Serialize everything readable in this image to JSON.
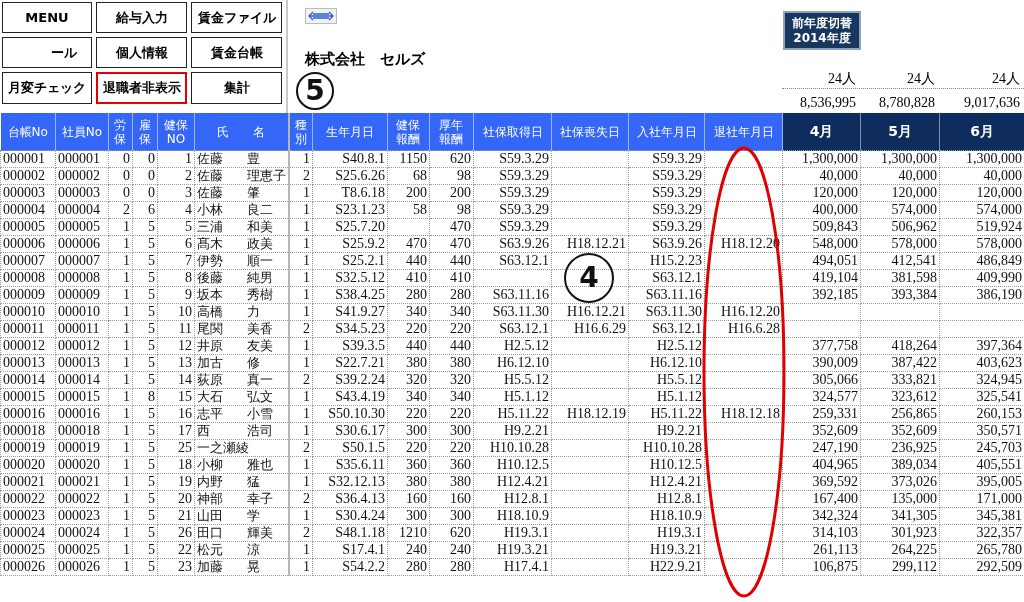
{
  "buttons": [
    {
      "label": "MENU",
      "highlighted": false
    },
    {
      "label": "給与入力",
      "highlighted": false
    },
    {
      "label": "賃金ファイル",
      "highlighted": false
    },
    {
      "label": "ール",
      "highlighted": false
    },
    {
      "label": "個人情報",
      "highlighted": false
    },
    {
      "label": "賃金台帳",
      "highlighted": false
    },
    {
      "label": "月変チェック",
      "highlighted": false
    },
    {
      "label": "退職者非表示",
      "highlighted": true
    },
    {
      "label": "集計",
      "highlighted": false
    }
  ],
  "company": "株式会社　セルズ",
  "year_switch": {
    "label": "前年度切替",
    "year": "2014年度"
  },
  "headcounts": [
    "24人",
    "24人",
    "24人"
  ],
  "totals": [
    "8,536,995",
    "8,780,828",
    "9,017,636"
  ],
  "columns": [
    "台帳No",
    "社員No",
    "労保",
    "雇保",
    "健保NO",
    "氏　　名",
    "種別",
    "生年月日",
    "健保報酬",
    "厚年報酬",
    "社保取得日",
    "社保喪失日",
    "入社年月日",
    "退社年月日",
    "4月",
    "5月",
    "6月"
  ],
  "rows": [
    {
      "ledger_no": "000001",
      "employee_no": "000001",
      "labor_ins": "0",
      "employment_ins": "0",
      "health_no": "1",
      "surname": "佐藤",
      "given_name": "豊",
      "type": "1",
      "birth_date": "S40.8.1",
      "health_pay": "1150",
      "pension_pay": "620",
      "ins_acquired": "S59.3.29",
      "hired": "S59.3.29",
      "m4": "1,300,000",
      "m5": "1,300,000",
      "m6": "1,300,000"
    },
    {
      "ledger_no": "000002",
      "employee_no": "000002",
      "labor_ins": "0",
      "employment_ins": "0",
      "health_no": "2",
      "surname": "佐藤",
      "given_name": "理恵子",
      "type": "2",
      "birth_date": "S25.6.26",
      "health_pay": "68",
      "pension_pay": "98",
      "ins_acquired": "S59.3.29",
      "hired": "S59.3.29",
      "m4": "40,000",
      "m5": "40,000",
      "m6": "40,000"
    },
    {
      "ledger_no": "000003",
      "employee_no": "000003",
      "labor_ins": "0",
      "employment_ins": "0",
      "health_no": "3",
      "surname": "佐藤",
      "given_name": "肇",
      "type": "1",
      "birth_date": "T8.6.18",
      "health_pay": "200",
      "pension_pay": "200",
      "ins_acquired": "S59.3.29",
      "hired": "S59.3.29",
      "m4": "120,000",
      "m5": "120,000",
      "m6": "120,000"
    },
    {
      "ledger_no": "000004",
      "employee_no": "000004",
      "labor_ins": "2",
      "employment_ins": "6",
      "health_no": "4",
      "surname": "小林",
      "given_name": "良二",
      "type": "1",
      "birth_date": "S23.1.23",
      "health_pay": "58",
      "pension_pay": "98",
      "ins_acquired": "S59.3.29",
      "hired": "S59.3.29",
      "m4": "400,000",
      "m5": "574,000",
      "m6": "574,000"
    },
    {
      "ledger_no": "000005",
      "employee_no": "000005",
      "labor_ins": "1",
      "employment_ins": "5",
      "health_no": "5",
      "surname": "三浦",
      "given_name": "和美",
      "type": "1",
      "birth_date": "S25.7.20",
      "pension_pay": "470",
      "ins_acquired": "S59.3.29",
      "hired": "S59.3.29",
      "m4": "509,843",
      "m5": "506,962",
      "m6": "519,924"
    },
    {
      "ledger_no": "000006",
      "employee_no": "000006",
      "labor_ins": "1",
      "employment_ins": "5",
      "health_no": "6",
      "surname": "髙木",
      "given_name": "政美",
      "type": "1",
      "birth_date": "S25.9.2",
      "health_pay": "470",
      "pension_pay": "470",
      "ins_acquired": "S63.9.26",
      "ins_lost": "H18.12.21",
      "hired": "S63.9.26",
      "retired": "H18.12.20",
      "m4": "548,000",
      "m5": "578,000",
      "m6": "578,000"
    },
    {
      "ledger_no": "000007",
      "employee_no": "000007",
      "labor_ins": "1",
      "employment_ins": "5",
      "health_no": "7",
      "surname": "伊勢",
      "given_name": "順一",
      "type": "1",
      "birth_date": "S25.2.1",
      "health_pay": "440",
      "pension_pay": "440",
      "ins_acquired": "S63.12.1",
      "hired": "H15.2.23",
      "m4": "494,051",
      "m5": "412,541",
      "m6": "486,849"
    },
    {
      "ledger_no": "000008",
      "employee_no": "000008",
      "labor_ins": "1",
      "employment_ins": "5",
      "health_no": "8",
      "surname": "後藤",
      "given_name": "純男",
      "type": "1",
      "birth_date": "S32.5.12",
      "health_pay": "410",
      "pension_pay": "410",
      "hired": "S63.12.1",
      "m4": "419,104",
      "m5": "381,598",
      "m6": "409,990"
    },
    {
      "ledger_no": "000009",
      "employee_no": "000009",
      "labor_ins": "1",
      "employment_ins": "5",
      "health_no": "9",
      "surname": "坂本",
      "given_name": "秀樹",
      "type": "1",
      "birth_date": "S38.4.25",
      "health_pay": "280",
      "pension_pay": "280",
      "ins_acquired": "S63.11.16",
      "hired": "S63.11.16",
      "m4": "392,185",
      "m5": "393,384",
      "m6": "386,190"
    },
    {
      "ledger_no": "000010",
      "employee_no": "000010",
      "labor_ins": "1",
      "employment_ins": "5",
      "health_no": "10",
      "surname": "高橋",
      "given_name": "力",
      "type": "1",
      "birth_date": "S41.9.27",
      "health_pay": "340",
      "pension_pay": "340",
      "ins_acquired": "S63.11.30",
      "ins_lost": "H16.12.21",
      "hired": "S63.11.30",
      "retired": "H16.12.20"
    },
    {
      "ledger_no": "000011",
      "employee_no": "000011",
      "labor_ins": "1",
      "employment_ins": "5",
      "health_no": "11",
      "surname": "尾関",
      "given_name": "美香",
      "type": "2",
      "birth_date": "S34.5.23",
      "health_pay": "220",
      "pension_pay": "220",
      "ins_acquired": "S63.12.1",
      "ins_lost": "H16.6.29",
      "hired": "S63.12.1",
      "retired": "H16.6.28"
    },
    {
      "ledger_no": "000012",
      "employee_no": "000012",
      "labor_ins": "1",
      "employment_ins": "5",
      "health_no": "12",
      "surname": "井原",
      "given_name": "友美",
      "type": "1",
      "birth_date": "S39.3.5",
      "health_pay": "440",
      "pension_pay": "440",
      "ins_acquired": "H2.5.12",
      "hired": "H2.5.12",
      "m4": "377,758",
      "m5": "418,264",
      "m6": "397,364"
    },
    {
      "ledger_no": "000013",
      "employee_no": "000013",
      "labor_ins": "1",
      "employment_ins": "5",
      "health_no": "13",
      "surname": "加古",
      "given_name": "修",
      "type": "1",
      "birth_date": "S22.7.21",
      "health_pay": "380",
      "pension_pay": "380",
      "ins_acquired": "H6.12.10",
      "hired": "H6.12.10",
      "m4": "390,009",
      "m5": "387,422",
      "m6": "403,623"
    },
    {
      "ledger_no": "000014",
      "employee_no": "000014",
      "labor_ins": "1",
      "employment_ins": "5",
      "health_no": "14",
      "surname": "荻原",
      "given_name": "真一",
      "type": "2",
      "birth_date": "S39.2.24",
      "health_pay": "320",
      "pension_pay": "320",
      "ins_acquired": "H5.5.12",
      "hired": "H5.5.12",
      "m4": "305,066",
      "m5": "333,821",
      "m6": "324,945"
    },
    {
      "ledger_no": "000015",
      "employee_no": "000015",
      "labor_ins": "1",
      "employment_ins": "8",
      "health_no": "15",
      "surname": "大石",
      "given_name": "弘文",
      "type": "1",
      "birth_date": "S43.4.19",
      "health_pay": "340",
      "pension_pay": "340",
      "ins_acquired": "H5.1.12",
      "hired": "H5.1.12",
      "m4": "324,577",
      "m5": "323,612",
      "m6": "325,541"
    },
    {
      "ledger_no": "000016",
      "employee_no": "000016",
      "labor_ins": "1",
      "employment_ins": "5",
      "health_no": "16",
      "surname": "志平",
      "given_name": "小雪",
      "type": "1",
      "birth_date": "S50.10.30",
      "health_pay": "220",
      "pension_pay": "220",
      "ins_acquired": "H5.11.22",
      "ins_lost": "H18.12.19",
      "hired": "H5.11.22",
      "retired": "H18.12.18",
      "m4": "259,331",
      "m5": "256,865",
      "m6": "260,153"
    },
    {
      "ledger_no": "000018",
      "employee_no": "000018",
      "labor_ins": "1",
      "employment_ins": "5",
      "health_no": "17",
      "surname": "西",
      "given_name": "浩司",
      "type": "1",
      "birth_date": "S30.6.17",
      "health_pay": "300",
      "pension_pay": "300",
      "ins_acquired": "H9.2.21",
      "hired": "H9.2.21",
      "m4": "352,609",
      "m5": "352,609",
      "m6": "350,571"
    },
    {
      "ledger_no": "000019",
      "employee_no": "000019",
      "labor_ins": "1",
      "employment_ins": "5",
      "health_no": "25",
      "surname": "一之瀬綾",
      "type": "2",
      "birth_date": "S50.1.5",
      "health_pay": "220",
      "pension_pay": "220",
      "ins_acquired": "H10.10.28",
      "hired": "H10.10.28",
      "m4": "247,190",
      "m5": "236,925",
      "m6": "245,703"
    },
    {
      "ledger_no": "000020",
      "employee_no": "000020",
      "labor_ins": "1",
      "employment_ins": "5",
      "health_no": "18",
      "surname": "小柳",
      "given_name": "雅也",
      "type": "1",
      "birth_date": "S35.6.11",
      "health_pay": "360",
      "pension_pay": "360",
      "ins_acquired": "H10.12.5",
      "hired": "H10.12.5",
      "m4": "404,965",
      "m5": "389,034",
      "m6": "405,551"
    },
    {
      "ledger_no": "000021",
      "employee_no": "000021",
      "labor_ins": "1",
      "employment_ins": "5",
      "health_no": "19",
      "surname": "内野",
      "given_name": "猛",
      "type": "1",
      "birth_date": "S32.12.13",
      "health_pay": "380",
      "pension_pay": "380",
      "ins_acquired": "H12.4.21",
      "hired": "H12.4.21",
      "m4": "369,592",
      "m5": "373,026",
      "m6": "395,005"
    },
    {
      "ledger_no": "000022",
      "employee_no": "000022",
      "labor_ins": "1",
      "employment_ins": "5",
      "health_no": "20",
      "surname": "神部",
      "given_name": "幸子",
      "type": "2",
      "birth_date": "S36.4.13",
      "health_pay": "160",
      "pension_pay": "160",
      "ins_acquired": "H12.8.1",
      "hired": "H12.8.1",
      "m4": "167,400",
      "m5": "135,000",
      "m6": "171,000"
    },
    {
      "ledger_no": "000023",
      "employee_no": "000023",
      "labor_ins": "1",
      "employment_ins": "5",
      "health_no": "21",
      "surname": "山田",
      "given_name": "学",
      "type": "1",
      "birth_date": "S30.4.24",
      "health_pay": "300",
      "pension_pay": "300",
      "ins_acquired": "H18.10.9",
      "hired": "H18.10.9",
      "m4": "342,324",
      "m5": "341,305",
      "m6": "345,381"
    },
    {
      "ledger_no": "000024",
      "employee_no": "000024",
      "labor_ins": "1",
      "employment_ins": "5",
      "health_no": "26",
      "surname": "田口",
      "given_name": "輝美",
      "type": "2",
      "birth_date": "S48.1.18",
      "health_pay": "1210",
      "pension_pay": "620",
      "ins_acquired": "H19.3.1",
      "hired": "H19.3.1",
      "m4": "314,103",
      "m5": "301,923",
      "m6": "322,357"
    },
    {
      "ledger_no": "000025",
      "employee_no": "000025",
      "labor_ins": "1",
      "employment_ins": "5",
      "health_no": "22",
      "surname": "松元",
      "given_name": "涼",
      "type": "1",
      "birth_date": "S17.4.1",
      "health_pay": "240",
      "pension_pay": "240",
      "ins_acquired": "H19.3.21",
      "hired": "H19.3.21",
      "m4": "261,113",
      "m5": "264,225",
      "m6": "265,780"
    },
    {
      "ledger_no": "000026",
      "employee_no": "000026",
      "labor_ins": "1",
      "employment_ins": "5",
      "health_no": "23",
      "surname": "加藤",
      "given_name": "晃",
      "type": "1",
      "birth_date": "S54.2.2",
      "health_pay": "280",
      "pension_pay": "280",
      "ins_acquired": "H17.4.1",
      "hired": "H22.9.21",
      "m4": "106,875",
      "m5": "299,112",
      "m6": "292,509"
    }
  ],
  "annotations": [
    {
      "kind": "circled-number",
      "text": "5"
    },
    {
      "kind": "circled-number",
      "text": "4"
    },
    {
      "kind": "ellipse"
    }
  ]
}
